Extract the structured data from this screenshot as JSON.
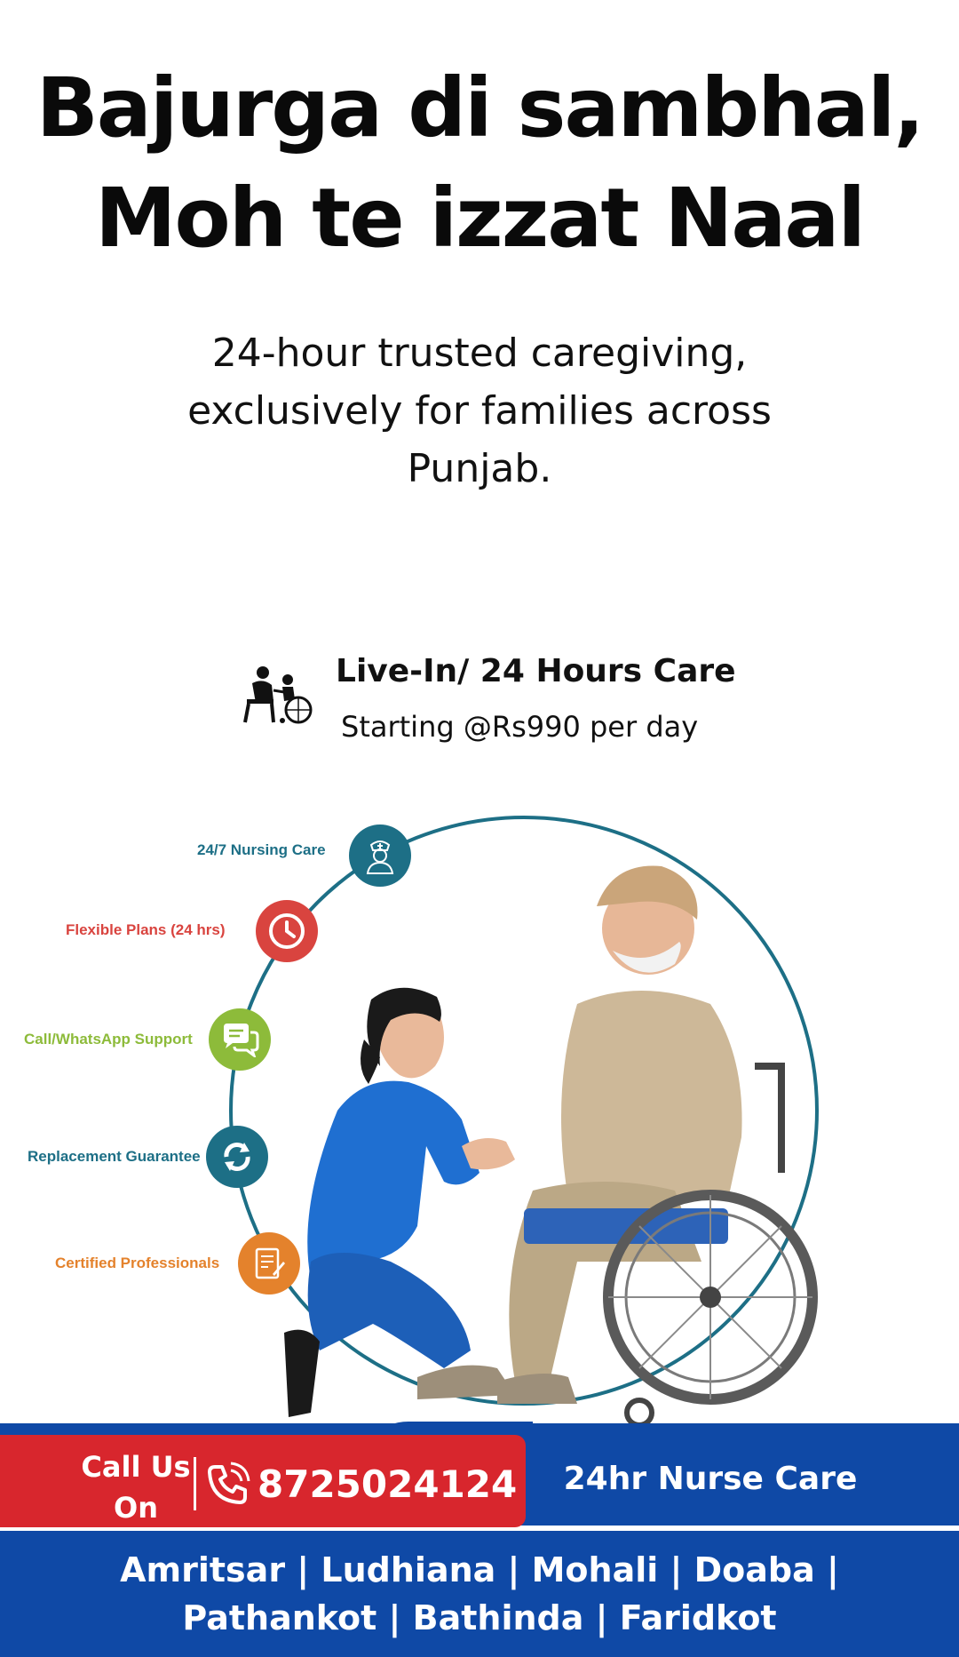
{
  "headline": {
    "line1": "Bajurga di sambhal,",
    "line2": "Moh te izzat Naal"
  },
  "subtitle": "24-hour trusted caregiving, exclusively for families across Punjab.",
  "plan": {
    "title": "Live-In/ 24 Hours Care",
    "price": "Starting @Rs990 per day",
    "icon": "caregiver-wheelchair-icon"
  },
  "features": [
    {
      "label": "24/7 Nursing Care",
      "icon": "nurse-icon",
      "color": "#1d6f86"
    },
    {
      "label": "Flexible Plans (24 hrs)",
      "icon": "clock-icon",
      "color": "#d9443f"
    },
    {
      "label": "Call/WhatsApp Support",
      "icon": "chat-icon",
      "color": "#8dbb3a"
    },
    {
      "label": "Replacement Guarantee",
      "icon": "refresh-icon",
      "color": "#1d6f86"
    },
    {
      "label": "Certified Professionals",
      "icon": "certificate-icon",
      "color": "#e4822c"
    }
  ],
  "cta": {
    "call_label": "Call Us On",
    "phone": "8725024124",
    "service": "24hr Nurse Care"
  },
  "cities": "Amritsar | Ludhiana | Mohali | Doaba | Pathankot | Bathinda | Faridkot",
  "colors": {
    "blue": "#0f49a6",
    "red": "#d8262d",
    "teal": "#1d6f86",
    "nurse_uniform": "#1f6fd1",
    "beige": "#cdb898"
  }
}
